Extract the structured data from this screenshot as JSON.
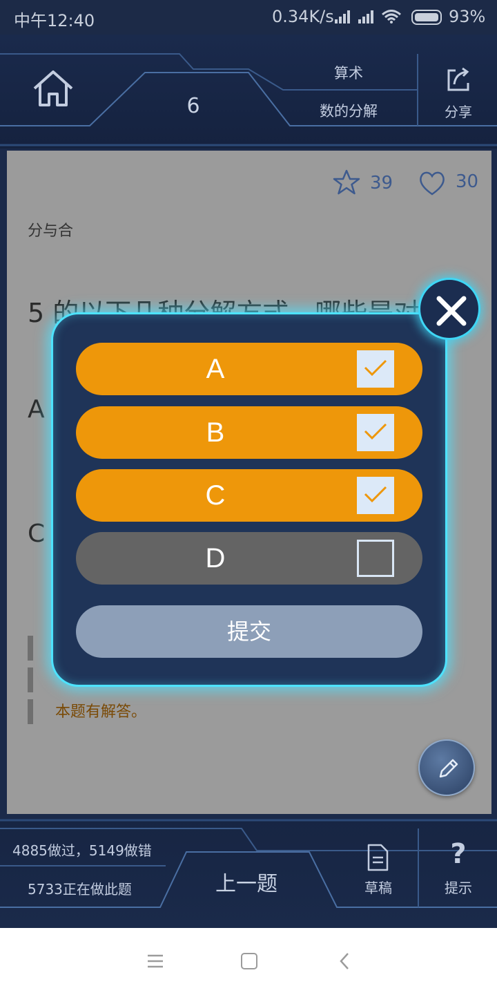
{
  "status_bar": {
    "time": "中午12:40",
    "speed": "0.34K/s",
    "battery": "93%"
  },
  "header": {
    "question_number": "6",
    "category": "算术",
    "subcategory": "数的分解",
    "share_label": "分享"
  },
  "question": {
    "star_count": "39",
    "like_count": "30",
    "topic": "分与合",
    "text": "5 的以下几种分解方式，哪些是对",
    "option_a_letter": "A",
    "option_c_letter": "C",
    "note": "本题有解答。"
  },
  "modal": {
    "choices": [
      {
        "label": "A",
        "checked": true
      },
      {
        "label": "B",
        "checked": true
      },
      {
        "label": "C",
        "checked": true
      },
      {
        "label": "D",
        "checked": false
      }
    ],
    "submit_label": "提交"
  },
  "bottom_bar": {
    "stats_line1": "4885做过，5149做错",
    "stats_line2": "5733正在做此题",
    "prev_label": "上一题",
    "draft_label": "草稿",
    "hint_label": "提示",
    "hint_icon": "?"
  },
  "colors": {
    "accent": "#ee970a",
    "glow": "#4de3ff",
    "modal_bg": "#1f3458",
    "unselected": "#646464",
    "submit": "#8d9fb8"
  }
}
